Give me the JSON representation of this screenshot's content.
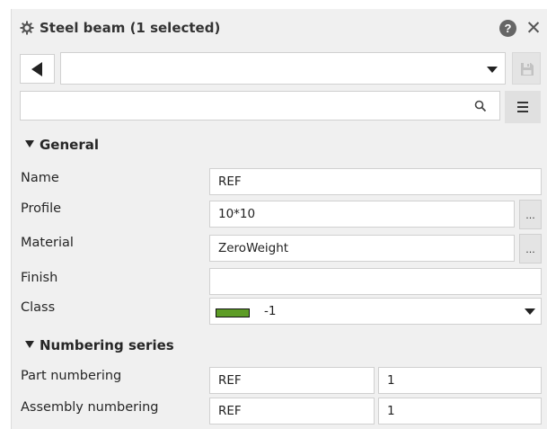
{
  "panel": {
    "title": "Steel beam (1 selected)",
    "help_symbol": "?",
    "close_symbol": "✕",
    "icons": {
      "title": "gear-icon",
      "help": "help-icon",
      "close": "close-icon",
      "back": "back-arrow-icon",
      "save": "save-icon",
      "search": "search-icon",
      "menu": "hamburger-menu-icon"
    }
  },
  "toolbar": {
    "preset_value": "",
    "search_value": "",
    "search_placeholder": ""
  },
  "sections": {
    "general": {
      "title": "General",
      "name": {
        "label": "Name",
        "value": "REF"
      },
      "profile": {
        "label": "Profile",
        "value": "10*10",
        "browse": "..."
      },
      "material": {
        "label": "Material",
        "value": "ZeroWeight",
        "browse": "..."
      },
      "finish": {
        "label": "Finish",
        "value": ""
      },
      "class": {
        "label": "Class",
        "value": "-1",
        "color": "#5d9c26"
      }
    },
    "numbering": {
      "title": "Numbering series",
      "part": {
        "label": "Part numbering",
        "prefix": "REF",
        "start": "1"
      },
      "assembly": {
        "label": "Assembly numbering",
        "prefix": "REF",
        "start": "1"
      }
    }
  }
}
